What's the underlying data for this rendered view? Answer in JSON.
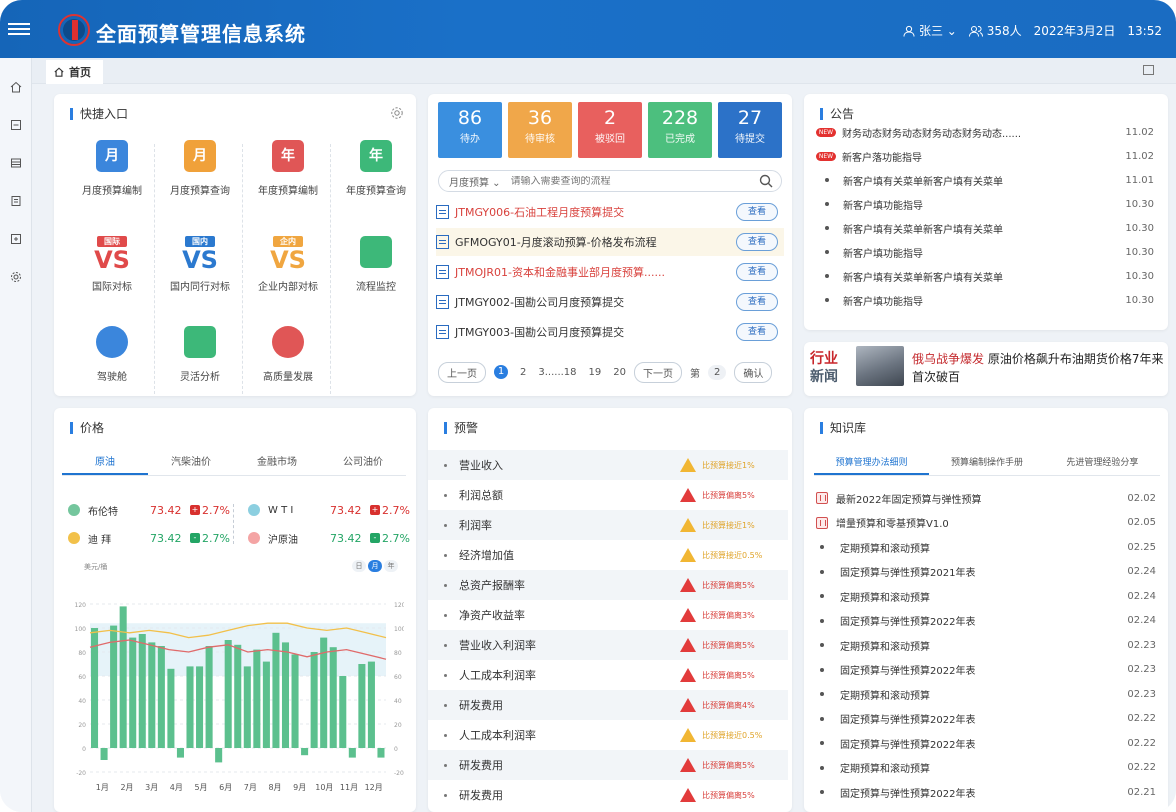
{
  "app": {
    "title": "全面预算管理信息系统"
  },
  "header": {
    "user": "张三",
    "online": "358人",
    "date": "2022年3月2日",
    "time": "13:52"
  },
  "tabs": {
    "home": "首页"
  },
  "quick_entry": {
    "title": "快捷入口",
    "items": [
      {
        "label": "月度预算编制",
        "icon": "月",
        "color": "#3b86dc"
      },
      {
        "label": "月度预算查询",
        "icon": "月",
        "color": "#f0a13a"
      },
      {
        "label": "年度预算编制",
        "icon": "年",
        "color": "#e05656"
      },
      {
        "label": "年度预算查询",
        "icon": "年",
        "color": "#3db879"
      },
      {
        "label": "国际对标",
        "icon": "VS",
        "tag": "国际",
        "color": "#e04a4a"
      },
      {
        "label": "国内同行对标",
        "icon": "VS",
        "tag": "国内",
        "color": "#2b79cf"
      },
      {
        "label": "企业内部对标",
        "icon": "VS",
        "tag": "企内",
        "color": "#f0a640"
      },
      {
        "label": "流程监控",
        "icon": "",
        "color": "#3db879"
      },
      {
        "label": "驾驶舱",
        "icon": "",
        "color": "#3b86dc"
      },
      {
        "label": "灵活分析",
        "icon": "",
        "color": "#3db879"
      },
      {
        "label": "高质量发展",
        "icon": "",
        "color": "#e05656"
      }
    ]
  },
  "stats": [
    {
      "num": "86",
      "label": "待办",
      "color": "#3a8fdf"
    },
    {
      "num": "36",
      "label": "待审核",
      "color": "#f0a74a"
    },
    {
      "num": "2",
      "label": "被驳回",
      "color": "#e8605e"
    },
    {
      "num": "228",
      "label": "已完成",
      "color": "#4cbf7e"
    },
    {
      "num": "27",
      "label": "待提交",
      "color": "#2c72c8"
    }
  ],
  "search": {
    "filter": "月度预算",
    "placeholder": "请输入需要查询的流程"
  },
  "flows": [
    {
      "text": "JTMGY006-石油工程月度预算提交",
      "color": "#d8413c",
      "btn": "查看"
    },
    {
      "text": "GFMOGY01-月度滚动预算-价格发布流程",
      "color": "#333333",
      "btn": "查看"
    },
    {
      "text": "JTMOJR01-资本和金融事业部月度预算......",
      "color": "#d8413c",
      "btn": "查看"
    },
    {
      "text": "JTMGY002-国勘公司月度预算提交",
      "color": "#333333",
      "btn": "查看"
    },
    {
      "text": "JTMGY003-国勘公司月度预算提交",
      "color": "#333333",
      "btn": "查看"
    }
  ],
  "pager": {
    "prev": "上一页",
    "pages": [
      "1",
      "2",
      "3......18",
      "19",
      "20"
    ],
    "next": "下一页",
    "goto": "第",
    "goto_val": "2",
    "confirm": "确认"
  },
  "notices": {
    "title": "公告",
    "items": [
      {
        "new": true,
        "text": "财务动态财务动态财务动态财务动态......",
        "date": "11.02"
      },
      {
        "new": true,
        "text": "新客户落功能指导",
        "date": "11.02"
      },
      {
        "new": false,
        "text": "新客户填有关菜单新客户填有关菜单",
        "date": "11.01"
      },
      {
        "new": false,
        "text": "新客户填功能指导",
        "date": "10.30"
      },
      {
        "new": false,
        "text": "新客户填有关菜单新客户填有关菜单",
        "date": "10.30"
      },
      {
        "new": false,
        "text": "新客户填功能指导",
        "date": "10.30"
      },
      {
        "new": false,
        "text": "新客户填有关菜单新客户填有关菜单",
        "date": "10.30"
      },
      {
        "new": false,
        "text": "新客户填功能指导",
        "date": "10.30"
      }
    ],
    "new_label": "NEW"
  },
  "news": {
    "tag1": "行业",
    "tag2": "新闻",
    "highlight": "俄乌战争爆发",
    "text": " 原油价格飙升布油期货价格7年来首次破百"
  },
  "price": {
    "title": "价格",
    "tabs": [
      "原油",
      "汽柴油价",
      "金融市场",
      "公司油价"
    ],
    "rows": [
      {
        "name": "布伦特",
        "value": "73.42",
        "change": "2.7%",
        "dir": "up",
        "dot": "#74c69d"
      },
      {
        "name": "W T I",
        "value": "73.42",
        "change": "2.7%",
        "dir": "up",
        "dot": "#8ccfe0"
      },
      {
        "name": "迪 拜",
        "value": "73.42",
        "change": "2.7%",
        "dir": "down",
        "dot": "#f2c14a"
      },
      {
        "name": "沪原油",
        "value": "73.42",
        "change": "2.7%",
        "dir": "down",
        "dot": "#f4a4a4"
      }
    ],
    "unit": "美元/桶",
    "toggle": [
      "日",
      "月",
      "年"
    ],
    "toggle_active": "月"
  },
  "chart_data": {
    "type": "bar",
    "categories": [
      "1月",
      "2月",
      "3月",
      "4月",
      "5月",
      "6月",
      "7月",
      "8月",
      "9月",
      "10月",
      "11月",
      "12月"
    ],
    "y_ticks": [
      "120",
      "100",
      "80",
      "60",
      "40",
      "20",
      "0",
      "-20"
    ],
    "ylim": [
      -20,
      125
    ],
    "series": [
      {
        "kind": "bar",
        "color": "#5cc08e",
        "values": [
          100,
          -10,
          102,
          118,
          92,
          95,
          88,
          85,
          66,
          -8,
          68,
          68,
          85,
          -12,
          90,
          86,
          68,
          82,
          72,
          96,
          88,
          78,
          -6,
          80,
          92,
          84,
          60,
          -8,
          70,
          72,
          -8
        ]
      },
      {
        "kind": "line",
        "color": "#f2c04a",
        "values": [
          96,
          98,
          96,
          98,
          96,
          92,
          94,
          98,
          102,
          104,
          104,
          100,
          98,
          100,
          96,
          92
        ]
      },
      {
        "kind": "line",
        "color": "#e06a6a",
        "values": [
          84,
          88,
          90,
          86,
          82,
          80,
          84,
          86,
          80,
          82,
          80,
          76,
          80,
          82,
          78,
          74
        ]
      }
    ]
  },
  "warnings": {
    "title": "预警",
    "items": [
      {
        "name": "营业收入",
        "level": "y",
        "status": "比预算接近1%"
      },
      {
        "name": "利润总额",
        "level": "r",
        "status": "比预算偏离5%"
      },
      {
        "name": "利润率",
        "level": "y",
        "status": "比预算接近1%"
      },
      {
        "name": "经济增加值",
        "level": "y",
        "status": "比预算接近0.5%"
      },
      {
        "name": "总资产报酬率",
        "level": "r",
        "status": "比预算偏离5%"
      },
      {
        "name": "净资产收益率",
        "level": "r",
        "status": "比预算偏离3%"
      },
      {
        "name": "营业收入利润率",
        "level": "r",
        "status": "比预算偏离5%"
      },
      {
        "name": "人工成本利润率",
        "level": "r",
        "status": "比预算偏离5%"
      },
      {
        "name": "研发费用",
        "level": "r",
        "status": "比预算偏离4%"
      },
      {
        "name": "人工成本利润率",
        "level": "y",
        "status": "比预算接近0.5%"
      },
      {
        "name": "研发费用",
        "level": "r",
        "status": "比预算偏离5%"
      },
      {
        "name": "研发费用",
        "level": "r",
        "status": "比预算偏离5%"
      }
    ]
  },
  "knowledge": {
    "title": "知识库",
    "tabs": [
      "预算管理办法细则",
      "预算编制操作手册",
      "先进管理经验分享"
    ],
    "items": [
      {
        "icon": true,
        "text": "最新2022年固定预算与弹性预算",
        "date": "02.02"
      },
      {
        "icon": true,
        "text": "增量预算和零基预算V1.0",
        "date": "02.05"
      },
      {
        "icon": false,
        "text": "定期预算和滚动预算",
        "date": "02.25"
      },
      {
        "icon": false,
        "text": "固定预算与弹性预算2021年表",
        "date": "02.24"
      },
      {
        "icon": false,
        "text": "定期预算和滚动预算",
        "date": "02.24"
      },
      {
        "icon": false,
        "text": "固定预算与弹性预算2022年表",
        "date": "02.24"
      },
      {
        "icon": false,
        "text": "定期预算和滚动预算",
        "date": "02.23"
      },
      {
        "icon": false,
        "text": "固定预算与弹性预算2022年表",
        "date": "02.23"
      },
      {
        "icon": false,
        "text": "定期预算和滚动预算",
        "date": "02.23"
      },
      {
        "icon": false,
        "text": "固定预算与弹性预算2022年表",
        "date": "02.22"
      },
      {
        "icon": false,
        "text": "固定预算与弹性预算2022年表",
        "date": "02.22"
      },
      {
        "icon": false,
        "text": "定期预算和滚动预算",
        "date": "02.22"
      },
      {
        "icon": false,
        "text": "固定预算与弹性预算2022年表",
        "date": "02.21"
      }
    ]
  }
}
